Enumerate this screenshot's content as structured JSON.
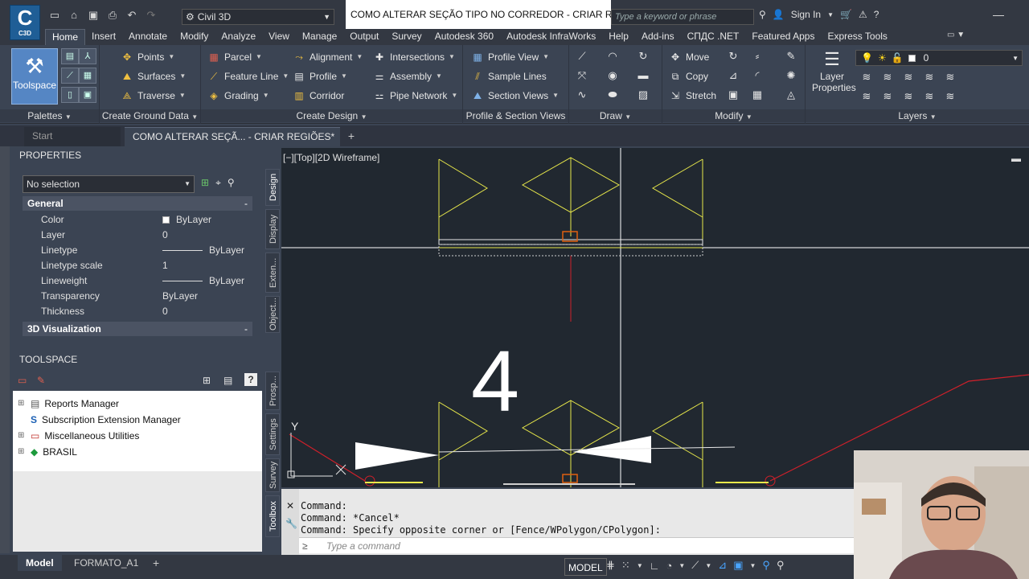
{
  "app": {
    "logo": "C",
    "logo_sub": "C3D",
    "workspace": "Civil 3D",
    "document_title": "COMO ALTERAR SEÇÃO TIPO NO CORREDOR - CRIAR RE...",
    "search_placeholder": "Type a keyword or phrase",
    "sign_in": "Sign In"
  },
  "ribbon_tabs": [
    "Home",
    "Insert",
    "Annotate",
    "Modify",
    "Analyze",
    "View",
    "Manage",
    "Output",
    "Survey",
    "Autodesk 360",
    "Autodesk InfraWorks",
    "Help",
    "Add-ins",
    "СПДС .NET",
    "Featured Apps",
    "Express Tools"
  ],
  "ribbon": {
    "palettes": {
      "title": "Palettes",
      "toolspace": "Toolspace"
    },
    "ground": {
      "title": "Create Ground Data",
      "points": "Points",
      "surfaces": "Surfaces",
      "traverse": "Traverse"
    },
    "design": {
      "title": "Create Design",
      "parcel": "Parcel",
      "feature_line": "Feature Line",
      "grading": "Grading",
      "alignment": "Alignment",
      "profile": "Profile",
      "corridor": "Corridor",
      "intersections": "Intersections",
      "assembly": "Assembly",
      "pipe_network": "Pipe Network"
    },
    "profile_views": {
      "title": "Profile & Section Views",
      "profile_view": "Profile View",
      "sample_lines": "Sample Lines",
      "section_views": "Section Views"
    },
    "draw": {
      "title": "Draw"
    },
    "modify": {
      "title": "Modify",
      "move": "Move",
      "copy": "Copy",
      "stretch": "Stretch"
    },
    "layers": {
      "title": "Layers",
      "layer_properties_1": "Layer",
      "layer_properties_2": "Properties",
      "current_layer": "0"
    }
  },
  "file_tabs": {
    "start": "Start",
    "document": "COMO ALTERAR SEÇÃ... - CRIAR REGIÕES*"
  },
  "properties": {
    "header": "PROPERTIES",
    "selection": "No selection",
    "general_title": "General",
    "rows": [
      {
        "name": "Color",
        "value": "ByLayer"
      },
      {
        "name": "Layer",
        "value": "0"
      },
      {
        "name": "Linetype",
        "value": "ByLayer"
      },
      {
        "name": "Linetype scale",
        "value": "1"
      },
      {
        "name": "Lineweight",
        "value": "ByLayer"
      },
      {
        "name": "Transparency",
        "value": "ByLayer"
      },
      {
        "name": "Thickness",
        "value": "0"
      }
    ],
    "viz_title": "3D Visualization",
    "collapse": "-",
    "side_tabs": [
      "Design",
      "Display",
      "Exten...",
      "Object..."
    ]
  },
  "toolspace": {
    "header": "TOOLSPACE",
    "items": [
      "Reports Manager",
      "Subscription Extension Manager",
      "Miscellaneous Utilities",
      "BRASIL"
    ],
    "side_tabs": [
      "Prosp...",
      "Settings",
      "Survey",
      "Toolbox"
    ]
  },
  "viewport": {
    "label": "[−][Top][2D Wireframe]",
    "overlay_number": "4",
    "y_axis": "Y"
  },
  "command": {
    "lines": [
      "Command:",
      "Command: *Cancel*",
      "Command: Specify opposite corner or [Fence/WPolygon/CPolygon]:"
    ],
    "placeholder": "Type a command",
    "prompt": "≥"
  },
  "status": {
    "layout_tabs": [
      "Model",
      "FORMATO_A1"
    ],
    "add": "+",
    "model_button": "MODEL"
  },
  "colors": {
    "drawing_bg": "#212830",
    "yellow": "#e8e84a",
    "red": "#d0202a",
    "accent": "#5586c4"
  }
}
